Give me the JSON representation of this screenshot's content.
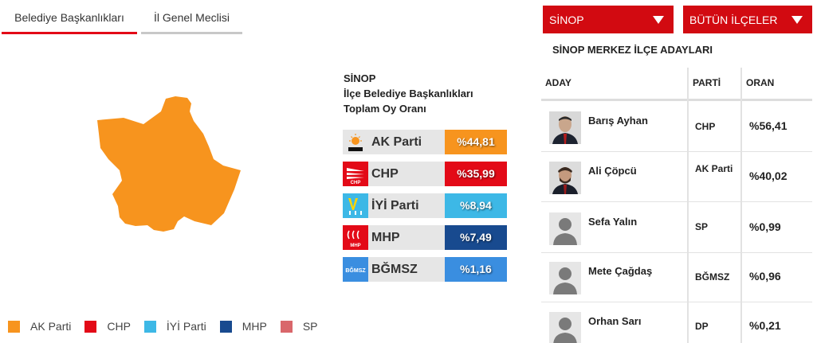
{
  "tabs": [
    {
      "label": "Belediye Başkanlıkları"
    },
    {
      "label": "İl Genel Meclisi"
    }
  ],
  "summary": {
    "line1": "SİNOP",
    "line2": "İlçe Belediye Başkanlıkları",
    "line3": "Toplam Oy Oranı"
  },
  "parties": [
    {
      "name": "AK Parti",
      "pct": "%44,81",
      "color": "#f7941e",
      "logo": "AK PARTİ"
    },
    {
      "name": "CHP",
      "pct": "%35,99",
      "color": "#e30a17",
      "logo": "CHP"
    },
    {
      "name": "İYİ Parti",
      "pct": "%8,94",
      "color": "#3db8e6",
      "logo": "İYİ"
    },
    {
      "name": "MHP",
      "pct": "%7,49",
      "color": "#184a8f",
      "logo": "MHP"
    },
    {
      "name": "BĞMSZ",
      "pct": "%1,16",
      "color": "#3a8ee0",
      "logo": "BĞMSZ"
    }
  ],
  "legend": [
    {
      "label": "AK Parti",
      "color": "#f7941e"
    },
    {
      "label": "CHP",
      "color": "#e30a17"
    },
    {
      "label": "İYİ Parti",
      "color": "#3db8e6"
    },
    {
      "label": "MHP",
      "color": "#184a8f"
    },
    {
      "label": "SP",
      "color": "#d9676b"
    }
  ],
  "map": {
    "region_color": "#f7941e"
  },
  "dropdowns": {
    "province": "SİNOP",
    "district": "BÜTÜN İLÇELER"
  },
  "candidates_title": "SİNOP MERKEZ İLÇE ADAYLARI",
  "table": {
    "headers": {
      "aday": "ADAY",
      "parti": "PARTİ",
      "oran": "ORAN"
    },
    "rows": [
      {
        "name": "Barış Ayhan",
        "party": "CHP",
        "pct": "%56,41",
        "photo": "person-photo"
      },
      {
        "name": "Ali Çöpcü",
        "party": "AK Parti",
        "pct": "%40,02",
        "photo": "person-photo"
      },
      {
        "name": "Sefa Yalın",
        "party": "SP",
        "pct": "%0,99",
        "photo": "placeholder-avatar"
      },
      {
        "name": "Mete Çağdaş",
        "party": "BĞMSZ",
        "pct": "%0,96",
        "photo": "placeholder-avatar"
      },
      {
        "name": "Orhan Sarı",
        "party": "DP",
        "pct": "%0,21",
        "photo": "placeholder-avatar"
      }
    ]
  }
}
